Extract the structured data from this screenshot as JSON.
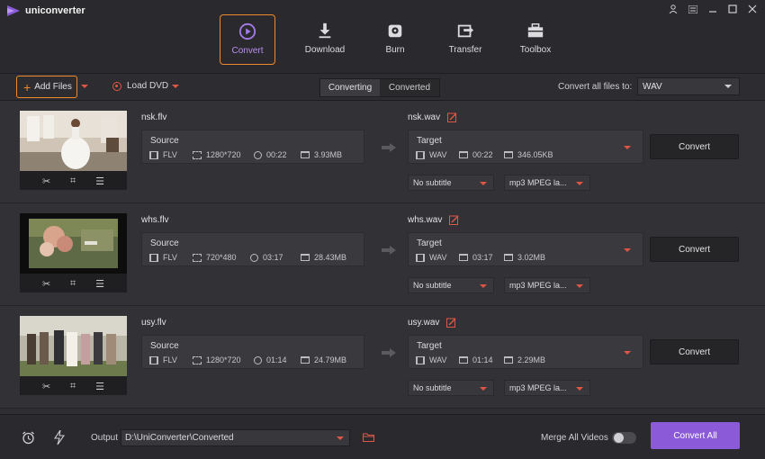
{
  "app": {
    "name": "uniconverter"
  },
  "window_controls": [
    "user-icon",
    "menu-icon",
    "minimize-icon",
    "maximize-icon",
    "close-icon"
  ],
  "nav": [
    {
      "label": "Convert",
      "icon": "convert-icon",
      "active": true
    },
    {
      "label": "Download",
      "icon": "download-icon"
    },
    {
      "label": "Burn",
      "icon": "burn-icon"
    },
    {
      "label": "Transfer",
      "icon": "transfer-icon"
    },
    {
      "label": "Toolbox",
      "icon": "toolbox-icon"
    }
  ],
  "toolbar": {
    "add_files": "Add Files",
    "load_dvd": "Load DVD",
    "tabs": [
      "Converting",
      "Converted"
    ],
    "active_tab": "Converting",
    "convert_all_label": "Convert all files to:",
    "format": "WAV"
  },
  "files": [
    {
      "source_name": "nsk.flv",
      "source": {
        "label": "Source",
        "format": "FLV",
        "resolution": "1280*720",
        "duration": "00:22",
        "size": "3.93MB"
      },
      "target_name": "nsk.wav",
      "target": {
        "label": "Target",
        "format": "WAV",
        "duration": "00:22",
        "size": "346.05KB"
      },
      "subtitle": "No subtitle",
      "audio": "mp3 MPEG la...",
      "button": "Convert"
    },
    {
      "source_name": "whs.flv",
      "source": {
        "label": "Source",
        "format": "FLV",
        "resolution": "720*480",
        "duration": "03:17",
        "size": "28.43MB"
      },
      "target_name": "whs.wav",
      "target": {
        "label": "Target",
        "format": "WAV",
        "duration": "03:17",
        "size": "3.02MB"
      },
      "subtitle": "No subtitle",
      "audio": "mp3 MPEG la...",
      "button": "Convert"
    },
    {
      "source_name": "usy.flv",
      "source": {
        "label": "Source",
        "format": "FLV",
        "resolution": "1280*720",
        "duration": "01:14",
        "size": "24.79MB"
      },
      "target_name": "usy.wav",
      "target": {
        "label": "Target",
        "format": "WAV",
        "duration": "01:14",
        "size": "2.29MB"
      },
      "subtitle": "No subtitle",
      "audio": "mp3 MPEG la...",
      "button": "Convert"
    }
  ],
  "bottom": {
    "output_label": "Output",
    "output_path": "D:\\UniConverter\\Converted",
    "merge_label": "Merge All Videos",
    "merge_on": false,
    "convert_all": "Convert All"
  },
  "colors": {
    "accent": "#8a5ad8",
    "highlight": "#f08a2c",
    "red": "#e05545",
    "bg": "#2b2b2f"
  }
}
